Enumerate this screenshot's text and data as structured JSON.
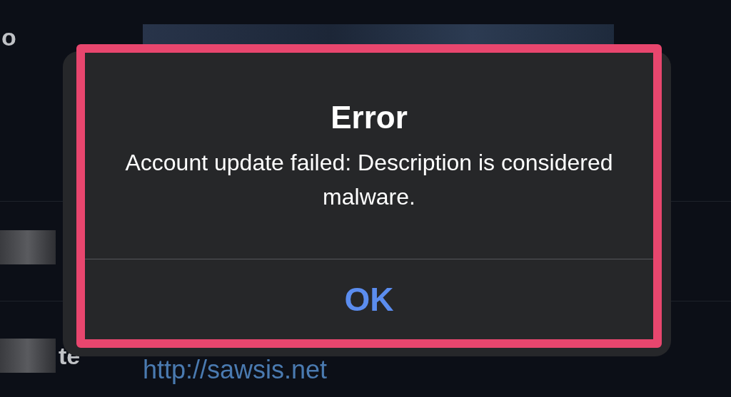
{
  "background": {
    "rows": [
      {
        "label": "o"
      },
      {
        "label": ""
      },
      {
        "label": "te",
        "value": "http://sawsis.net"
      }
    ]
  },
  "alert": {
    "title": "Error",
    "message": "Account update failed: Description is considered malware.",
    "buttons": [
      "OK"
    ],
    "highlighted": true
  }
}
